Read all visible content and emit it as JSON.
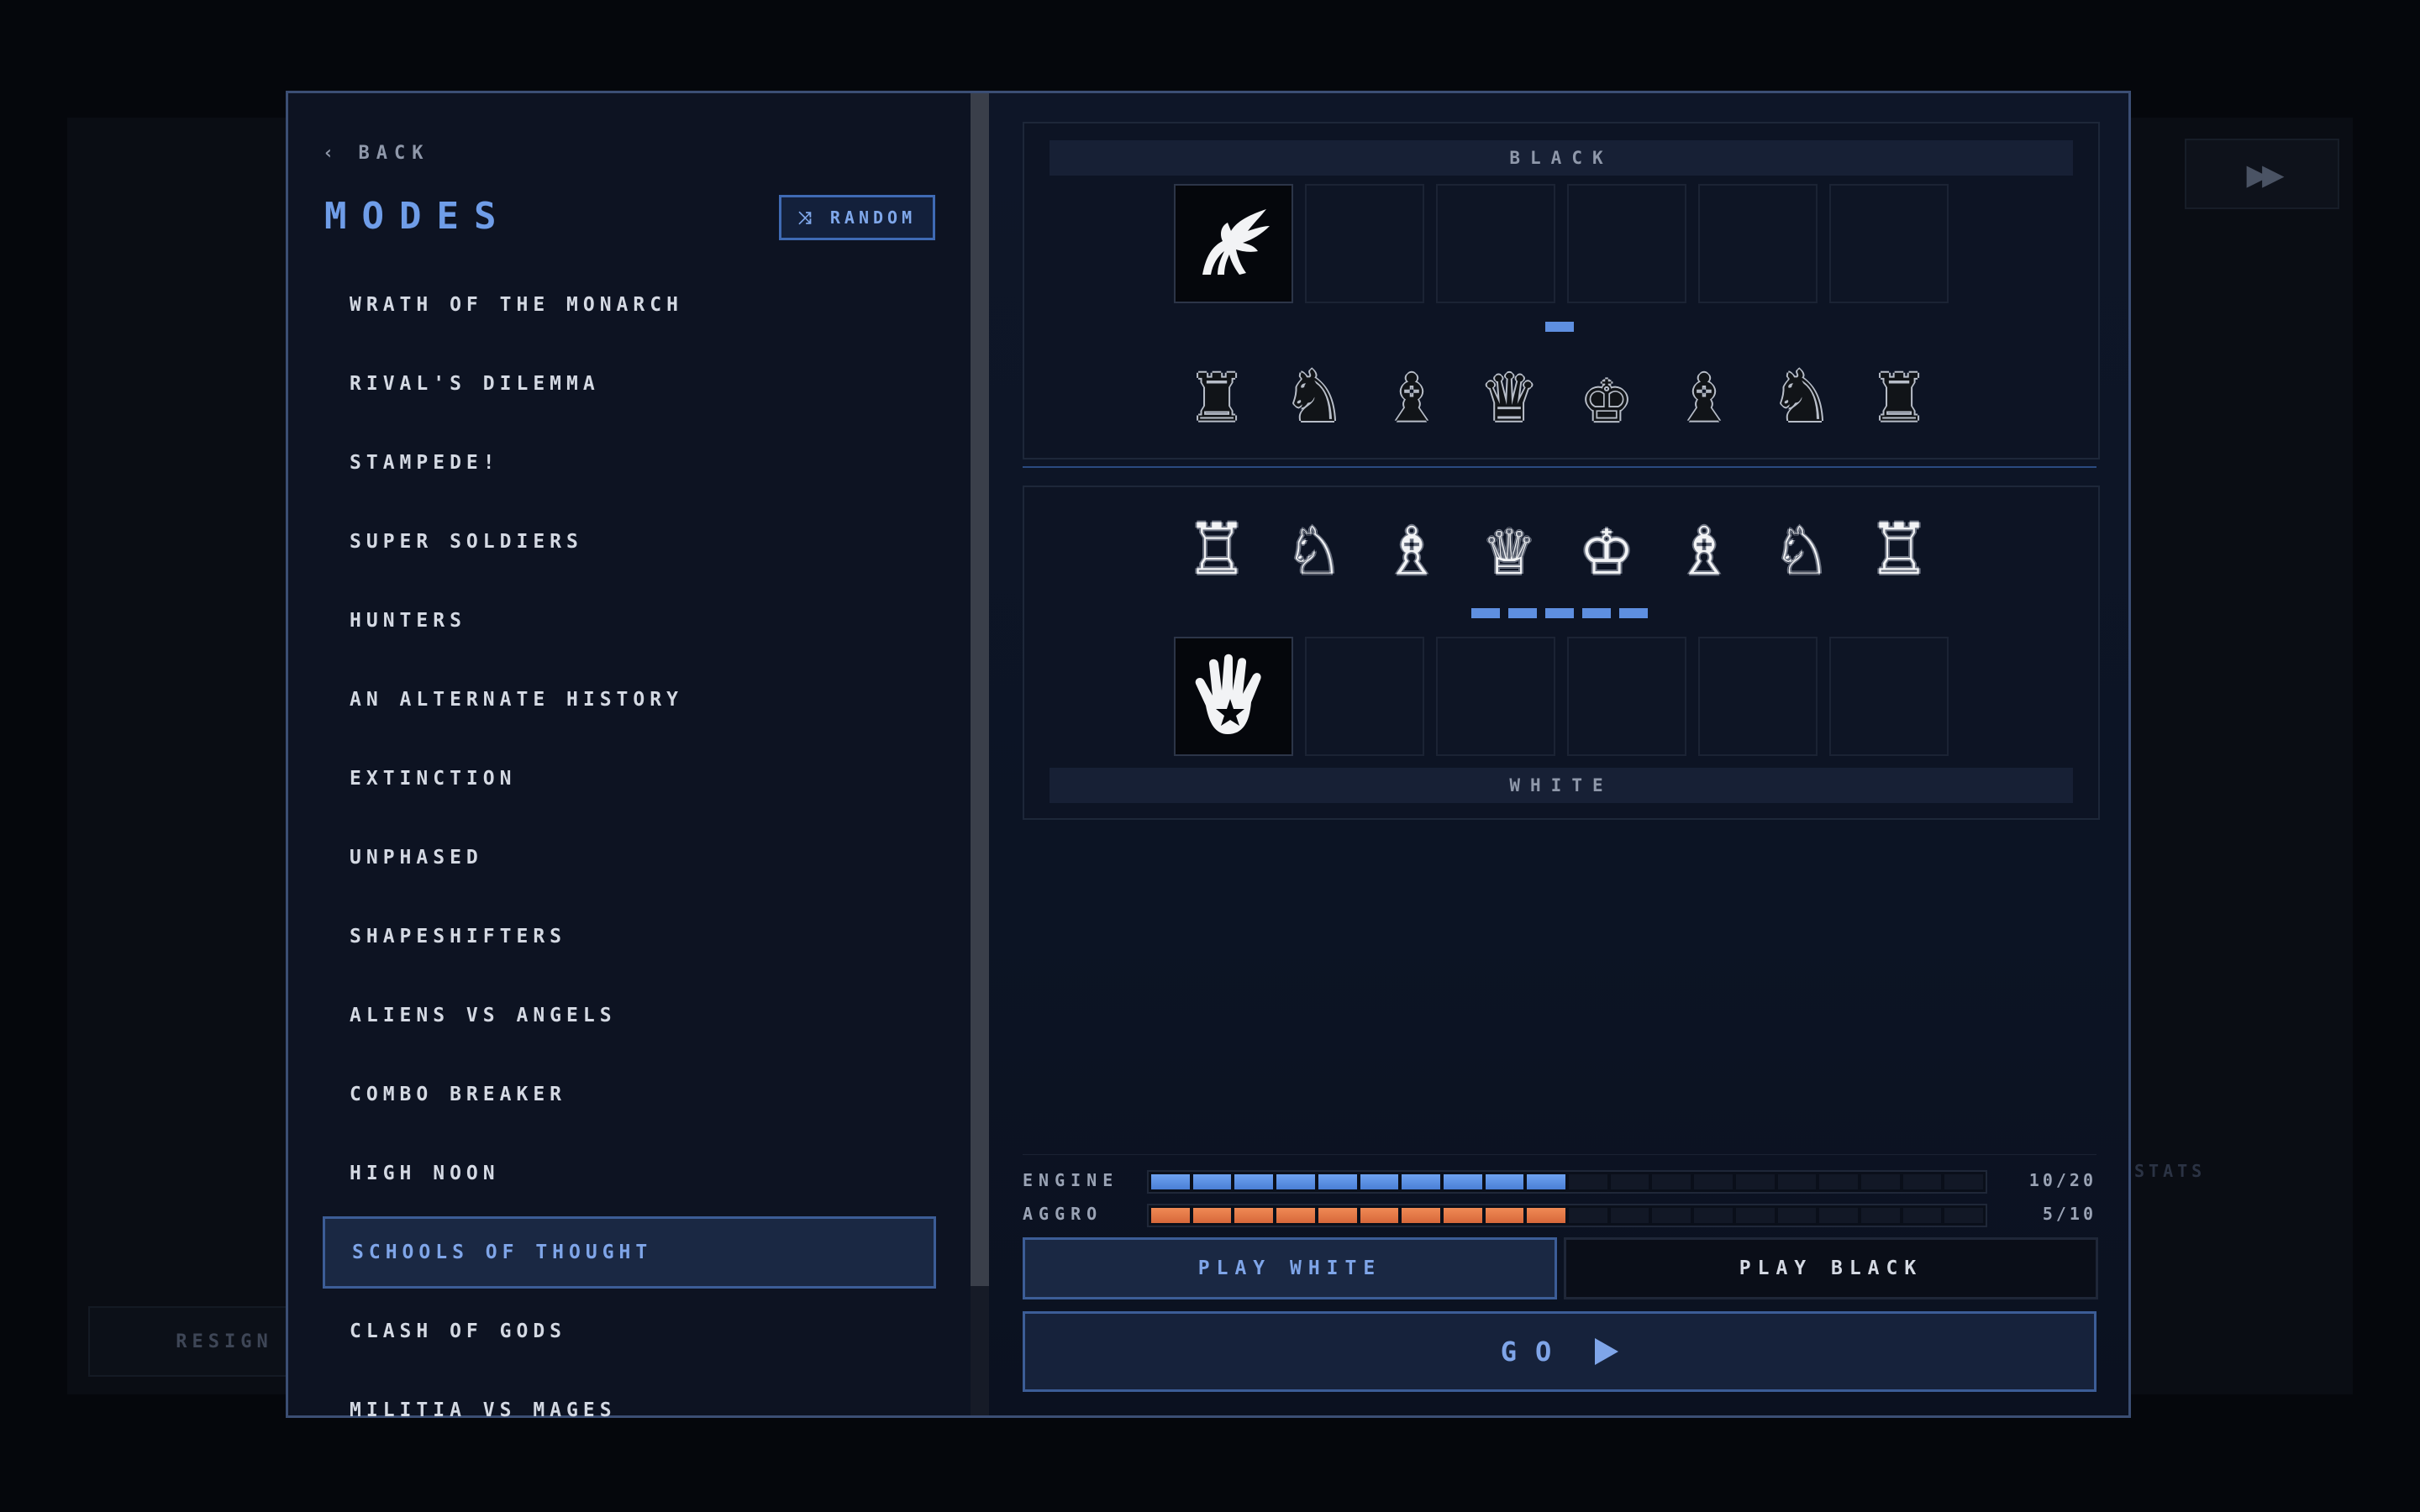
{
  "background": {
    "fast_forward_icon": "▶▶",
    "resign_label": "RESIGN",
    "stats_label": "STATS"
  },
  "sidebar": {
    "back_label": "‹ BACK",
    "title": "MODES",
    "random_label": "⤨ RANDOM",
    "modes": [
      "WRATH OF THE MONARCH",
      "RIVAL'S DILEMMA",
      "STAMPEDE!",
      "SUPER SOLDIERS",
      "HUNTERS",
      "AN ALTERNATE HISTORY",
      "EXTINCTION",
      "UNPHASED",
      "SHAPESHIFTERS",
      "ALIENS VS ANGELS",
      "COMBO BREAKER",
      "HIGH NOON",
      "SCHOOLS OF THOUGHT",
      "CLASH OF GODS",
      "MILITIA VS MAGES"
    ],
    "selected_mode": "SCHOOLS OF THOUGHT"
  },
  "black_side": {
    "label": "BLACK",
    "ability_icon": "winged-creature-icon",
    "pieces": [
      "♜",
      "♞",
      "♝",
      "♛",
      "♚",
      "♝",
      "♞",
      "♜"
    ],
    "pips": 1
  },
  "white_side": {
    "label": "WHITE",
    "ability_icon": "star-hand-icon",
    "pieces": [
      "♖",
      "♘",
      "♗",
      "♕",
      "♔",
      "♗",
      "♘",
      "♖"
    ],
    "pips": 5
  },
  "settings": {
    "engine": {
      "label": "ENGINE",
      "value": 10,
      "max": 20,
      "display": "10/20",
      "color": "#5e8fe0"
    },
    "aggro": {
      "label": "AGGRO",
      "value": 5,
      "max": 10,
      "display": "5/10",
      "color": "#e27544"
    }
  },
  "buttons": {
    "play_white": "PLAY WHITE",
    "play_black": "PLAY BLACK",
    "go": "GO"
  },
  "colors": {
    "accent": "#6f9de8",
    "panel_bg": "#0b1120"
  }
}
